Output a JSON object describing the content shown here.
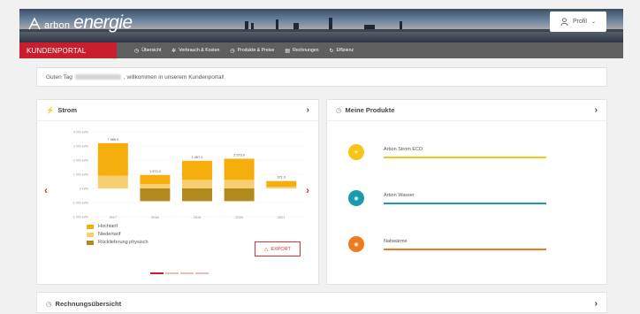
{
  "brand": {
    "small": "arbon",
    "big": "energie"
  },
  "header": {
    "profile_label": "Profil"
  },
  "nav": {
    "portal_label": "KUNDENPORTAL",
    "items": [
      {
        "label": "Übersicht",
        "icon": "clock-icon"
      },
      {
        "label": "Verbrauch & Kosten",
        "icon": "plug-icon"
      },
      {
        "label": "Produkte & Preise",
        "icon": "tag-icon"
      },
      {
        "label": "Rechnungen",
        "icon": "document-icon"
      },
      {
        "label": "Effizienz",
        "icon": "leaf-icon"
      }
    ]
  },
  "greeting": {
    "before": "Guten Tag",
    "after": ", willkommen in unserem Kundenportal!"
  },
  "strom_card": {
    "title": "Strom",
    "legend": [
      "Hochtarif",
      "Niedertarif",
      "Rücklieferung physisch"
    ],
    "export_label": "EXPORT",
    "colors": {
      "hochtarif": "#f5ae0c",
      "niedertarif": "#f8cf70",
      "rueck": "#b08a1c"
    }
  },
  "chart_data": {
    "type": "bar",
    "categories": [
      "2017",
      "2018",
      "2019",
      "2020",
      "2021"
    ],
    "totals_labels": [
      "7 989.0",
      "1 972.0",
      "1 467.0",
      "2 373.0",
      "371.0"
    ],
    "y_ticks": [
      "4 000 kWh",
      "3 000 kWh",
      "2 000 kWh",
      "1 000 kWh",
      "0 kWh",
      "-1 000 kWh",
      "-2 000 kWh"
    ],
    "ylim": [
      -2000,
      4000
    ],
    "series": [
      {
        "name": "Hochtarif",
        "values": [
          2300,
          650,
          1350,
          1500,
          400
        ]
      },
      {
        "name": "Niedertarif",
        "values": [
          900,
          300,
          600,
          600,
          120
        ]
      },
      {
        "name": "Rücklieferung physisch",
        "values": [
          0,
          -900,
          -900,
          -900,
          0
        ]
      }
    ]
  },
  "produkte_card": {
    "title": "Meine Produkte",
    "items": [
      {
        "name": "Arbon Strom ECO",
        "color": "#f5c617",
        "icon": "bulb-icon"
      },
      {
        "name": "Arbon Wasser",
        "color": "#1a9bab",
        "icon": "water-icon"
      },
      {
        "name": "Nahwärme",
        "color": "#ee7b1f",
        "icon": "flame-icon"
      }
    ]
  },
  "rechnung_card": {
    "title": "Rechnungsübersicht"
  }
}
